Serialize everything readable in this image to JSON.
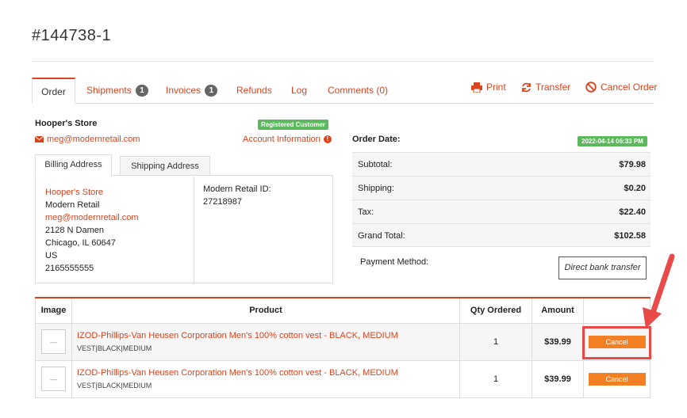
{
  "order": {
    "id": "#144738-1"
  },
  "tabs": [
    {
      "label": "Order"
    },
    {
      "label": "Shipments",
      "badge": "1"
    },
    {
      "label": "Invoices",
      "badge": "1"
    },
    {
      "label": "Refunds"
    },
    {
      "label": "Log"
    },
    {
      "label": "Comments (0)"
    }
  ],
  "actions": {
    "print": "Print",
    "transfer": "Transfer",
    "cancel_order": "Cancel Order"
  },
  "customer": {
    "store": "Hooper's Store",
    "status_badge": "Registered Customer",
    "email": "meg@modernretail.com",
    "account_info": "Account Information"
  },
  "address_tabs": {
    "billing": "Billing Address",
    "shipping": "Shipping Address"
  },
  "billing": {
    "name": "Hooper's Store",
    "company": "Modern Retail",
    "email": "meg@modernretail.com",
    "street": "2128 N Damen",
    "city": "Chicago, IL 60647",
    "country": "US",
    "phone": "2165555555",
    "retail_id_label": "Modern Retail ID:",
    "retail_id": "27218987"
  },
  "summary": {
    "order_date_label": "Order Date:",
    "order_date": "2022-04-14 06:33 PM",
    "rows": [
      {
        "label": "Subtotal:",
        "value": "$79.98"
      },
      {
        "label": "Shipping:",
        "value": "$0.20"
      },
      {
        "label": "Tax:",
        "value": "$22.40"
      },
      {
        "label": "Grand Total:",
        "value": "$102.58"
      }
    ],
    "payment_label": "Payment Method:",
    "payment_method": "Direct bank transfer"
  },
  "items_table": {
    "headers": [
      "Image",
      "Product",
      "Qty Ordered",
      "Amount",
      ""
    ],
    "rows": [
      {
        "title": "IZOD-Phillips-Van Heusen Corporation Men's 100% cotton vest - BLACK, MEDIUM",
        "sku": "VEST|BLACK|MEDIUM",
        "qty": "1",
        "amount": "$39.99",
        "action": "Cancel"
      },
      {
        "title": "IZOD-Phillips-Van Heusen Corporation Men's 100% cotton vest - BLACK, MEDIUM",
        "sku": "VEST|BLACK|MEDIUM",
        "qty": "1",
        "amount": "$39.99",
        "action": "Cancel"
      }
    ]
  },
  "colors": {
    "accent": "#d9431e",
    "success": "#5cb85c",
    "button": "#f48024",
    "annotation": "#e84a4a"
  },
  "icons": [
    "print-icon",
    "transfer-icon",
    "cancel-order-icon",
    "email-icon",
    "info-icon",
    "arrow-annotation"
  ]
}
